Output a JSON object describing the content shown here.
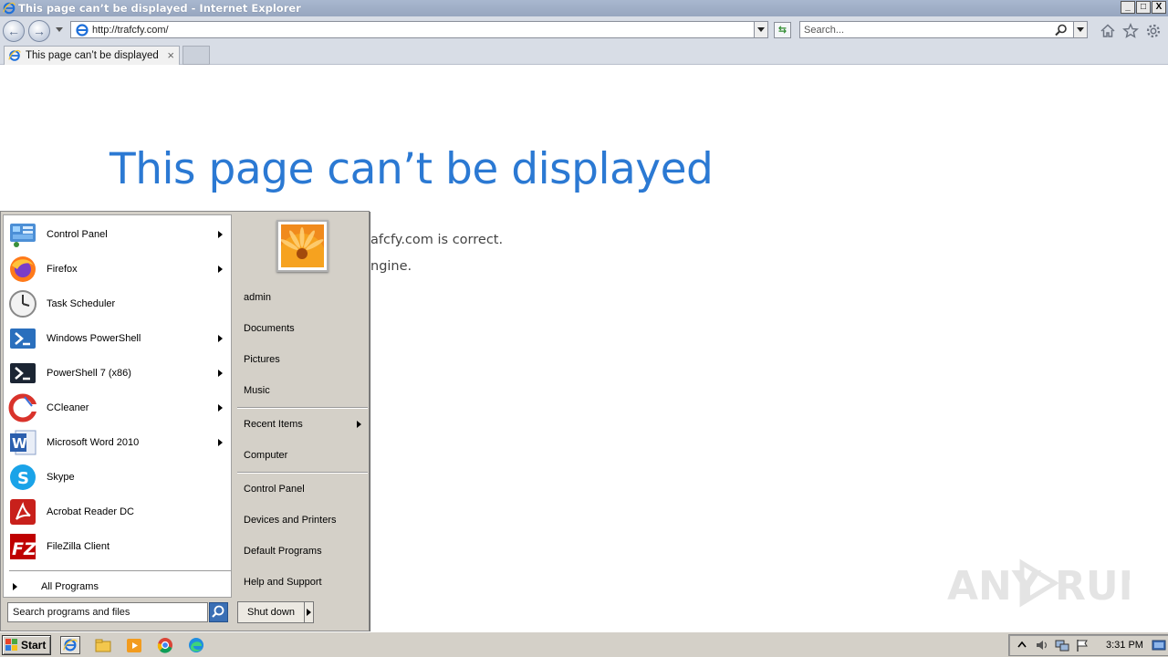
{
  "window": {
    "title": "This page can’t be displayed - Internet Explorer",
    "buttons": [
      "_",
      "□",
      "X"
    ]
  },
  "navbar": {
    "address": "http://trafcfy.com/",
    "search_placeholder": "Search..."
  },
  "tabs": [
    {
      "label": "This page can’t be displayed",
      "close": "×"
    }
  ],
  "page": {
    "heading": "This page can’t be displayed",
    "line1_visible": "afcfy.com is correct.",
    "line2_visible": "ngine."
  },
  "start_menu": {
    "programs": [
      {
        "label": "Control Panel",
        "icon": "control-panel-icon",
        "submenu": true
      },
      {
        "label": "Firefox",
        "icon": "firefox-icon",
        "submenu": true
      },
      {
        "label": "Task Scheduler",
        "icon": "task-scheduler-icon",
        "submenu": false
      },
      {
        "label": "Windows PowerShell",
        "icon": "powershell-icon",
        "submenu": true
      },
      {
        "label": "PowerShell 7 (x86)",
        "icon": "powershell7-icon",
        "submenu": true
      },
      {
        "label": "CCleaner",
        "icon": "ccleaner-icon",
        "submenu": true
      },
      {
        "label": "Microsoft Word 2010",
        "icon": "word-icon",
        "submenu": true
      },
      {
        "label": "Skype",
        "icon": "skype-icon",
        "submenu": false
      },
      {
        "label": "Acrobat Reader DC",
        "icon": "acrobat-icon",
        "submenu": false
      },
      {
        "label": "FileZilla Client",
        "icon": "filezilla-icon",
        "submenu": false
      }
    ],
    "all_programs": "All Programs",
    "search_placeholder": "Search programs and files",
    "right": {
      "user": "admin",
      "documents": "Documents",
      "pictures": "Pictures",
      "music": "Music",
      "recent_items": "Recent Items",
      "computer": "Computer",
      "control_panel": "Control Panel",
      "devices_printers": "Devices and Printers",
      "default_programs": "Default Programs",
      "help_support": "Help and Support"
    },
    "shutdown": "Shut down"
  },
  "taskbar": {
    "start": "Start",
    "clock": "3:31 PM"
  },
  "watermark": "ANY RUN",
  "colors": {
    "heading_blue": "#2b79d3",
    "menu_gray": "#d4d0c8"
  }
}
